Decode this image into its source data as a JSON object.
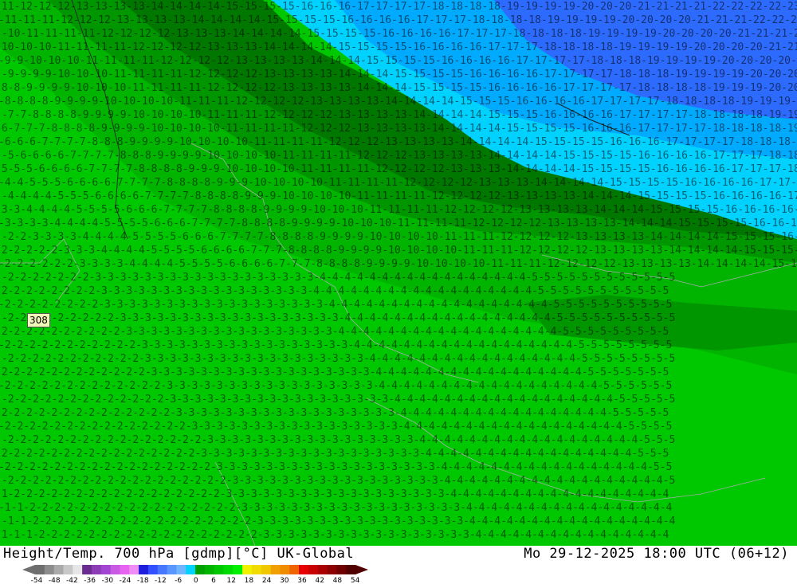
{
  "header": {
    "title": "Height/Temp. 700 hPa [gdmp][°C] UK-Global",
    "valid_time": "Mo 29-12-2025 18:00 UTC (06+12)"
  },
  "map": {
    "station_marker": "308",
    "colors": {
      "land_green_1": "#00c800",
      "land_green_2": "#00b400",
      "land_green_3": "#009600",
      "land_green_4": "#007800",
      "cold_cyan": "#00d2ff",
      "cold_cyan_2": "#00aaff",
      "cold_blue": "#2d6bff"
    }
  },
  "legend": {
    "ticks": [
      "-54",
      "-48",
      "-42",
      "-36",
      "-30",
      "-24",
      "-18",
      "-12",
      "-6",
      "0",
      "6",
      "12",
      "18",
      "24",
      "30",
      "36",
      "42",
      "48",
      "54"
    ],
    "colors": [
      "#6e6e6e",
      "#8c8c8c",
      "#aaaaaa",
      "#c8c8c8",
      "#e6e6e6",
      "#6a2d8f",
      "#8c3cb4",
      "#a046d2",
      "#c85ae6",
      "#e664f0",
      "#f08cf5",
      "#1e1edc",
      "#3250ff",
      "#4678ff",
      "#5a96ff",
      "#6eb4ff",
      "#00d2ff",
      "#00a000",
      "#00b400",
      "#00c800",
      "#00dc00",
      "#00f000",
      "#f0f000",
      "#f0dc00",
      "#f0c800",
      "#f0a000",
      "#f08c00",
      "#f06400",
      "#e60000",
      "#c80000",
      "#aa0000",
      "#8c0000",
      "#6e0000",
      "#500000"
    ]
  }
}
